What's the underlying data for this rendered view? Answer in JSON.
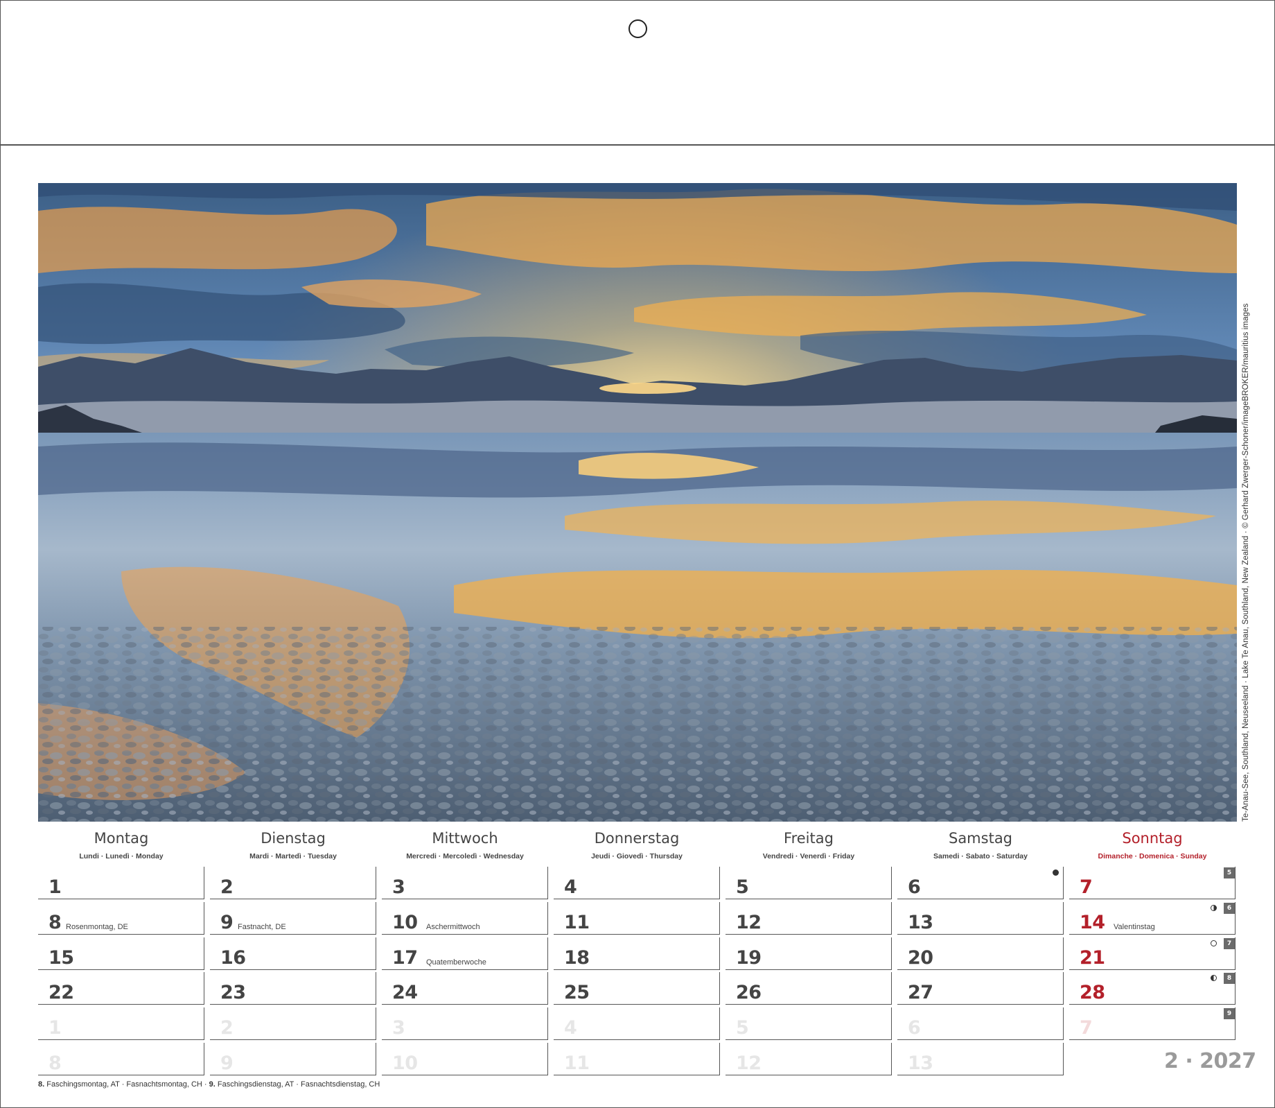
{
  "photo": {
    "credit": "Te-Anau-See, Southland, Neuseeland · Lake Te Anau, Southland, New Zealand · © Gerhard Zwerger-Schoner/imageBROKER/mauritius images"
  },
  "weekdays": [
    {
      "name": "Montag",
      "sub": "Lundi · Lunedì · Monday"
    },
    {
      "name": "Dienstag",
      "sub": "Mardi · Martedì · Tuesday"
    },
    {
      "name": "Mittwoch",
      "sub": "Mercredi · Mercoledì · Wednesday"
    },
    {
      "name": "Donnerstag",
      "sub": "Jeudi · Giovedì · Thursday"
    },
    {
      "name": "Freitag",
      "sub": "Vendredi · Venerdì · Friday"
    },
    {
      "name": "Samstag",
      "sub": "Samedi · Sabato · Saturday"
    },
    {
      "name": "Sonntag",
      "sub": "Dimanche · Domenica · Sunday"
    }
  ],
  "weeks": [
    {
      "days": [
        "1",
        "2",
        "3",
        "4",
        "5",
        "6",
        "7"
      ],
      "week_number": "5"
    },
    {
      "days": [
        "8",
        "9",
        "10",
        "11",
        "12",
        "13",
        "14"
      ],
      "week_number": "6"
    },
    {
      "days": [
        "15",
        "16",
        "17",
        "18",
        "19",
        "20",
        "21"
      ],
      "week_number": "7"
    },
    {
      "days": [
        "22",
        "23",
        "24",
        "25",
        "26",
        "27",
        "28"
      ],
      "week_number": "8"
    },
    {
      "days": [
        "1",
        "2",
        "3",
        "4",
        "5",
        "6",
        "7"
      ],
      "week_number": "9"
    },
    {
      "days": [
        "8",
        "9",
        "10",
        "11",
        "12",
        "13",
        ""
      ],
      "week_number": ""
    }
  ],
  "holidays": {
    "d8": "Rosenmontag, DE",
    "d9": "Fastnacht, DE",
    "d10": "Aschermittwoch",
    "d14": "Valentinstag",
    "d17": "Quatemberwoche"
  },
  "month_year": "2 · 2027",
  "footnotes": {
    "f1_day": "8.",
    "f1_text": "Faschingsmontag, AT",
    "f2_text": "Fasnachtsmontag, CH",
    "f3_day": "9.",
    "f3_text": "Faschingsdienstag, AT",
    "f4_text": "Fasnachtsdienstag, CH",
    "separator": "·"
  },
  "colors": {
    "sunday_red": "#b3202a",
    "text_gray": "#444444",
    "faded_gray": "#e6e6e6",
    "badge_gray": "#6a6a6a"
  },
  "icons": {
    "moon_new": "new-moon-icon",
    "moon_first_quarter": "first-quarter-moon-icon",
    "moon_full": "full-moon-icon",
    "moon_last_quarter": "last-quarter-moon-icon"
  }
}
